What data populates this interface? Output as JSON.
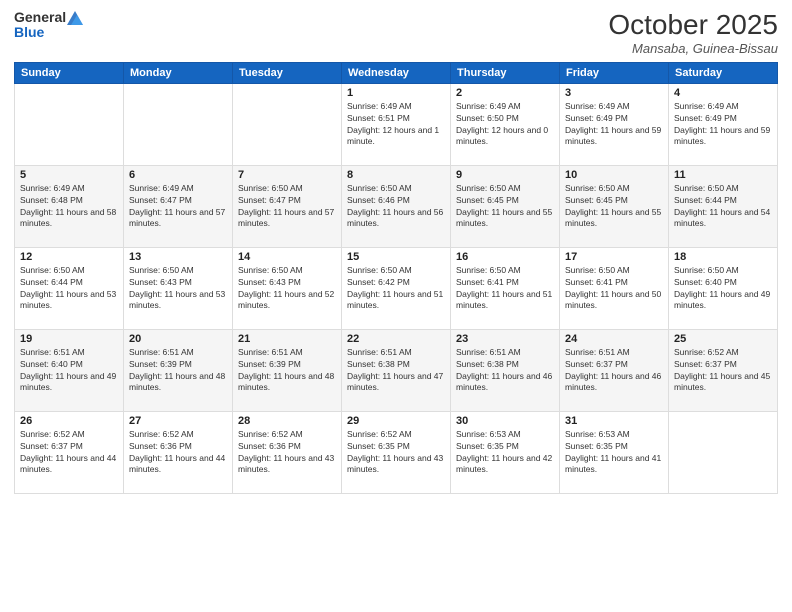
{
  "header": {
    "logo_general": "General",
    "logo_blue": "Blue",
    "month_title": "October 2025",
    "location": "Mansaba, Guinea-Bissau"
  },
  "weekdays": [
    "Sunday",
    "Monday",
    "Tuesday",
    "Wednesday",
    "Thursday",
    "Friday",
    "Saturday"
  ],
  "weeks": [
    [
      {
        "day": "",
        "sunrise": "",
        "sunset": "",
        "daylight": ""
      },
      {
        "day": "",
        "sunrise": "",
        "sunset": "",
        "daylight": ""
      },
      {
        "day": "",
        "sunrise": "",
        "sunset": "",
        "daylight": ""
      },
      {
        "day": "1",
        "sunrise": "Sunrise: 6:49 AM",
        "sunset": "Sunset: 6:51 PM",
        "daylight": "Daylight: 12 hours and 1 minute."
      },
      {
        "day": "2",
        "sunrise": "Sunrise: 6:49 AM",
        "sunset": "Sunset: 6:50 PM",
        "daylight": "Daylight: 12 hours and 0 minutes."
      },
      {
        "day": "3",
        "sunrise": "Sunrise: 6:49 AM",
        "sunset": "Sunset: 6:49 PM",
        "daylight": "Daylight: 11 hours and 59 minutes."
      },
      {
        "day": "4",
        "sunrise": "Sunrise: 6:49 AM",
        "sunset": "Sunset: 6:49 PM",
        "daylight": "Daylight: 11 hours and 59 minutes."
      }
    ],
    [
      {
        "day": "5",
        "sunrise": "Sunrise: 6:49 AM",
        "sunset": "Sunset: 6:48 PM",
        "daylight": "Daylight: 11 hours and 58 minutes."
      },
      {
        "day": "6",
        "sunrise": "Sunrise: 6:49 AM",
        "sunset": "Sunset: 6:47 PM",
        "daylight": "Daylight: 11 hours and 57 minutes."
      },
      {
        "day": "7",
        "sunrise": "Sunrise: 6:50 AM",
        "sunset": "Sunset: 6:47 PM",
        "daylight": "Daylight: 11 hours and 57 minutes."
      },
      {
        "day": "8",
        "sunrise": "Sunrise: 6:50 AM",
        "sunset": "Sunset: 6:46 PM",
        "daylight": "Daylight: 11 hours and 56 minutes."
      },
      {
        "day": "9",
        "sunrise": "Sunrise: 6:50 AM",
        "sunset": "Sunset: 6:45 PM",
        "daylight": "Daylight: 11 hours and 55 minutes."
      },
      {
        "day": "10",
        "sunrise": "Sunrise: 6:50 AM",
        "sunset": "Sunset: 6:45 PM",
        "daylight": "Daylight: 11 hours and 55 minutes."
      },
      {
        "day": "11",
        "sunrise": "Sunrise: 6:50 AM",
        "sunset": "Sunset: 6:44 PM",
        "daylight": "Daylight: 11 hours and 54 minutes."
      }
    ],
    [
      {
        "day": "12",
        "sunrise": "Sunrise: 6:50 AM",
        "sunset": "Sunset: 6:44 PM",
        "daylight": "Daylight: 11 hours and 53 minutes."
      },
      {
        "day": "13",
        "sunrise": "Sunrise: 6:50 AM",
        "sunset": "Sunset: 6:43 PM",
        "daylight": "Daylight: 11 hours and 53 minutes."
      },
      {
        "day": "14",
        "sunrise": "Sunrise: 6:50 AM",
        "sunset": "Sunset: 6:43 PM",
        "daylight": "Daylight: 11 hours and 52 minutes."
      },
      {
        "day": "15",
        "sunrise": "Sunrise: 6:50 AM",
        "sunset": "Sunset: 6:42 PM",
        "daylight": "Daylight: 11 hours and 51 minutes."
      },
      {
        "day": "16",
        "sunrise": "Sunrise: 6:50 AM",
        "sunset": "Sunset: 6:41 PM",
        "daylight": "Daylight: 11 hours and 51 minutes."
      },
      {
        "day": "17",
        "sunrise": "Sunrise: 6:50 AM",
        "sunset": "Sunset: 6:41 PM",
        "daylight": "Daylight: 11 hours and 50 minutes."
      },
      {
        "day": "18",
        "sunrise": "Sunrise: 6:50 AM",
        "sunset": "Sunset: 6:40 PM",
        "daylight": "Daylight: 11 hours and 49 minutes."
      }
    ],
    [
      {
        "day": "19",
        "sunrise": "Sunrise: 6:51 AM",
        "sunset": "Sunset: 6:40 PM",
        "daylight": "Daylight: 11 hours and 49 minutes."
      },
      {
        "day": "20",
        "sunrise": "Sunrise: 6:51 AM",
        "sunset": "Sunset: 6:39 PM",
        "daylight": "Daylight: 11 hours and 48 minutes."
      },
      {
        "day": "21",
        "sunrise": "Sunrise: 6:51 AM",
        "sunset": "Sunset: 6:39 PM",
        "daylight": "Daylight: 11 hours and 48 minutes."
      },
      {
        "day": "22",
        "sunrise": "Sunrise: 6:51 AM",
        "sunset": "Sunset: 6:38 PM",
        "daylight": "Daylight: 11 hours and 47 minutes."
      },
      {
        "day": "23",
        "sunrise": "Sunrise: 6:51 AM",
        "sunset": "Sunset: 6:38 PM",
        "daylight": "Daylight: 11 hours and 46 minutes."
      },
      {
        "day": "24",
        "sunrise": "Sunrise: 6:51 AM",
        "sunset": "Sunset: 6:37 PM",
        "daylight": "Daylight: 11 hours and 46 minutes."
      },
      {
        "day": "25",
        "sunrise": "Sunrise: 6:52 AM",
        "sunset": "Sunset: 6:37 PM",
        "daylight": "Daylight: 11 hours and 45 minutes."
      }
    ],
    [
      {
        "day": "26",
        "sunrise": "Sunrise: 6:52 AM",
        "sunset": "Sunset: 6:37 PM",
        "daylight": "Daylight: 11 hours and 44 minutes."
      },
      {
        "day": "27",
        "sunrise": "Sunrise: 6:52 AM",
        "sunset": "Sunset: 6:36 PM",
        "daylight": "Daylight: 11 hours and 44 minutes."
      },
      {
        "day": "28",
        "sunrise": "Sunrise: 6:52 AM",
        "sunset": "Sunset: 6:36 PM",
        "daylight": "Daylight: 11 hours and 43 minutes."
      },
      {
        "day": "29",
        "sunrise": "Sunrise: 6:52 AM",
        "sunset": "Sunset: 6:35 PM",
        "daylight": "Daylight: 11 hours and 43 minutes."
      },
      {
        "day": "30",
        "sunrise": "Sunrise: 6:53 AM",
        "sunset": "Sunset: 6:35 PM",
        "daylight": "Daylight: 11 hours and 42 minutes."
      },
      {
        "day": "31",
        "sunrise": "Sunrise: 6:53 AM",
        "sunset": "Sunset: 6:35 PM",
        "daylight": "Daylight: 11 hours and 41 minutes."
      },
      {
        "day": "",
        "sunrise": "",
        "sunset": "",
        "daylight": ""
      }
    ]
  ]
}
